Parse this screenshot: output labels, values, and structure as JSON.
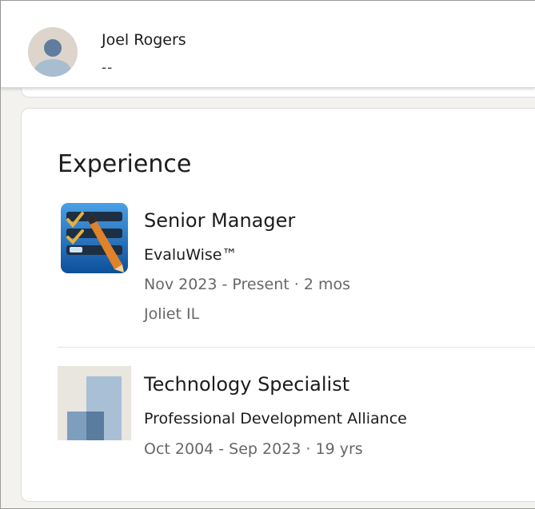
{
  "header": {
    "name": "Joel Rogers",
    "subtitle": "--"
  },
  "experience": {
    "heading": "Experience",
    "items": [
      {
        "title": "Senior Manager",
        "company": "EvaluWise™",
        "dates": "Nov 2023 - Present · 2 mos",
        "location": "Joliet IL",
        "logo_icon": "evaluwise-logo-icon"
      },
      {
        "title": "Technology Specialist",
        "company": "Professional Development Alliance",
        "dates": "Oct 2004 - Sep 2023 · 19 yrs",
        "logo_icon": "company-placeholder-logo-icon"
      }
    ]
  },
  "colors": {
    "page_background": "#f3f2ef",
    "card_background": "#ffffff",
    "primary_text": "#1c1c1c",
    "secondary_text": "#676767",
    "avatar_background": "#ddd5cc",
    "avatar_figure": "#5f7d9f",
    "placeholder_logo_light": "#a8bfd6",
    "placeholder_logo_dark": "#5a7c9f"
  }
}
